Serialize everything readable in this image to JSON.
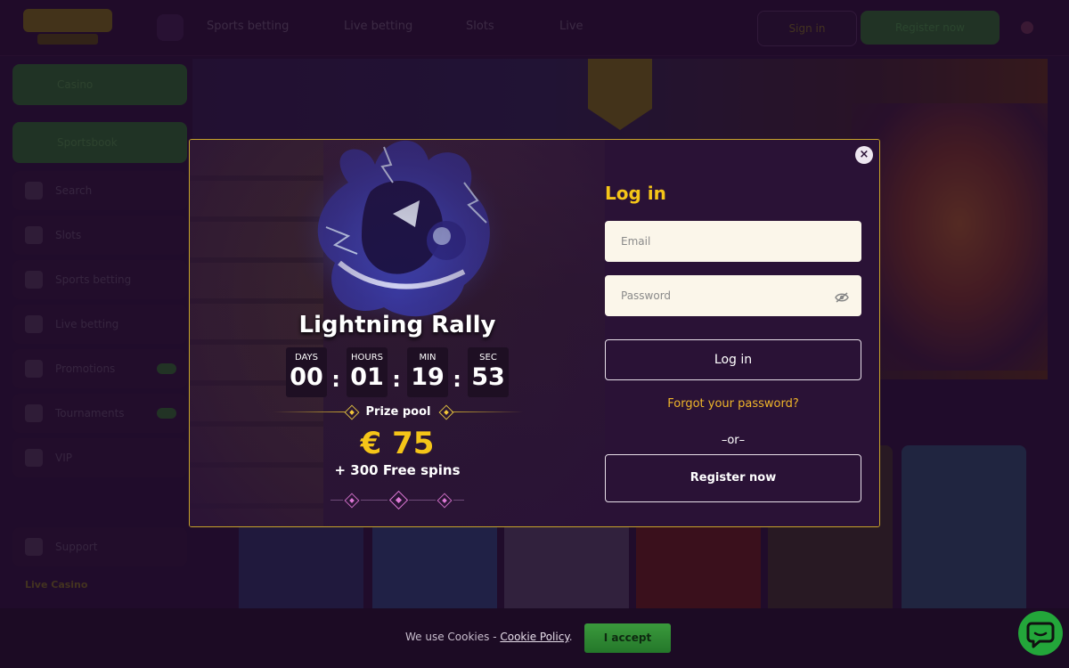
{
  "background_page": {
    "nav": [
      "Sports betting",
      "Live betting",
      "Slots",
      "Live"
    ],
    "signin_label": "Sign in",
    "register_label": "Register now",
    "sidebar": [
      "Casino",
      "Sportsbook",
      "Search",
      "Slots",
      "Sports betting",
      "Live betting",
      "Promotions",
      "Tournaments",
      "VIP",
      "Support"
    ],
    "sidebar_section": "Live Casino"
  },
  "promo": {
    "title": "Lightning Rally",
    "countdown": [
      {
        "label": "DAYS",
        "value": "00"
      },
      {
        "label": "HOURS",
        "value": "01"
      },
      {
        "label": "MIN",
        "value": "19"
      },
      {
        "label": "SEC",
        "value": "53"
      }
    ],
    "separator": ":",
    "prize_label": "Prize pool",
    "prize_amount": "€ 75",
    "prize_extra": "+ 300 Free spins"
  },
  "login": {
    "title": "Log in",
    "email_placeholder": "Email",
    "password_placeholder": "Password",
    "login_button": "Log in",
    "forgot_password": "Forgot your password?",
    "or_label": "–or–",
    "register_button": "Register now",
    "close_icon": "×"
  },
  "cookie": {
    "text": "We use Cookies - ",
    "policy_link": "Cookie Policy",
    "suffix": ".",
    "accept_label": "I accept"
  },
  "colors": {
    "accent_gold": "#f5c518",
    "modal_border": "#c7a42a",
    "accept_green": "#2e8b34",
    "chat_green": "#23a63a"
  },
  "icons": [
    "close-icon",
    "eye-off-icon",
    "chat-icon",
    "search-icon"
  ]
}
